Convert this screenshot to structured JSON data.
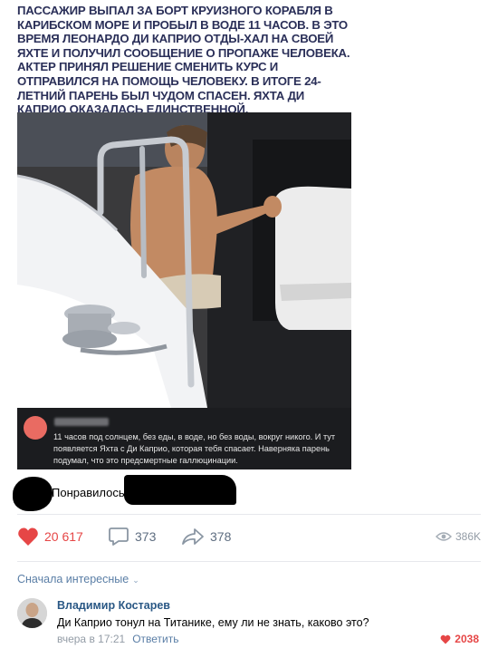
{
  "meme": {
    "title": "Пассажир выпал за борт круизного корабля в Карибском море и пробыл в воде 11 часов. В это время Леонардо Ди Каприо отды-хал на своей яхте и получил сообщение о пропаже человека. Актер принял решение сменить курс и отправился на помощь человеку. В итоге 24-летний парень был чудом спасен. Яхта Ди Каприо оказалась единственной, отозвавшейся на просьбу о помощи.",
    "comment_text": "11 часов под солнцем, без еды, в воде, но без воды, вокруг никого. И тут появляется Яхта с Ди Каприо, которая тебя спасает. Наверняка парень подумал, что это предсмертные галлюцинации."
  },
  "liked": {
    "label": "Понравилось"
  },
  "actions": {
    "likes": "20 617",
    "comments": "373",
    "shares": "378",
    "views": "386K"
  },
  "comments_section": {
    "sort_label": "Сначала интересные"
  },
  "top_comment": {
    "author": "Владимир Костарев",
    "text": "Ди Каприо тонул на Титанике, ему ли не знать, каково это?",
    "time": "вчера в 17:21",
    "reply_label": "Ответить",
    "likes": "2038"
  },
  "colors": {
    "accent_red": "#e64646",
    "link_blue": "#2a5885",
    "muted": "#939ca6"
  },
  "icons": [
    "heart-icon",
    "comment-icon",
    "share-icon",
    "eye-icon",
    "chevron-down-icon"
  ]
}
